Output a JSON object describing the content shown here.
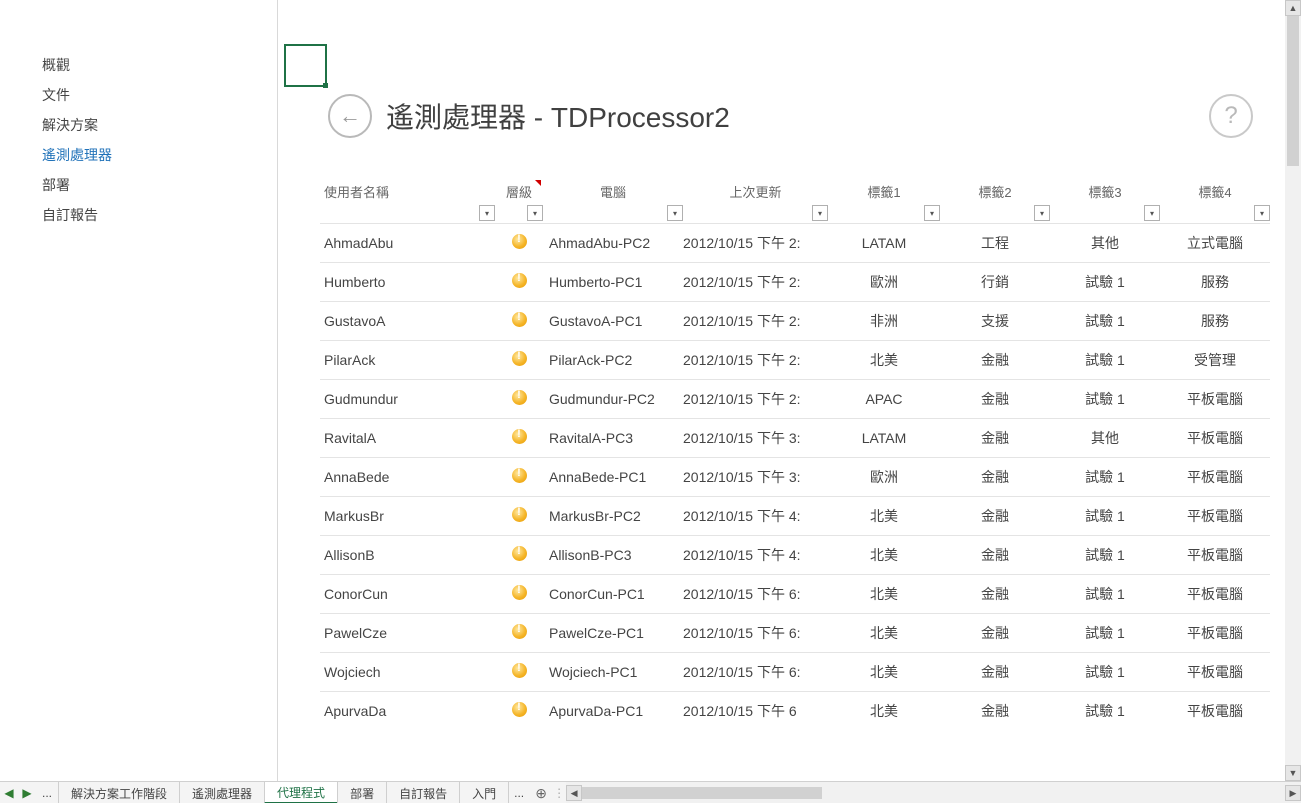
{
  "sidebar": {
    "items": [
      "概觀",
      "文件",
      "解決方案",
      "遙測處理器",
      "部署",
      "自訂報告"
    ],
    "selected_index": 3
  },
  "header": {
    "title": "遙測處理器 - TDProcessor2"
  },
  "columns": [
    "使用者名稱",
    "層級",
    "電腦",
    "上次更新",
    "標籤1",
    "標籤2",
    "標籤3",
    "標籤4"
  ],
  "column_with_marker": 1,
  "rows": [
    {
      "user": "AhmadAbu",
      "pc": "AhmadAbu-PC2",
      "updated": "2012/10/15 下午 2:",
      "t1": "LATAM",
      "t2": "工程",
      "t3": "其他",
      "t4": "立式電腦"
    },
    {
      "user": "Humberto",
      "pc": "Humberto-PC1",
      "updated": "2012/10/15 下午 2:",
      "t1": "歐洲",
      "t2": "行銷",
      "t3": "試驗 1",
      "t4": "服務"
    },
    {
      "user": "GustavoA",
      "pc": "GustavoA-PC1",
      "updated": "2012/10/15 下午 2:",
      "t1": "非洲",
      "t2": "支援",
      "t3": "試驗 1",
      "t4": "服務"
    },
    {
      "user": "PilarAck",
      "pc": "PilarAck-PC2",
      "updated": "2012/10/15 下午 2:",
      "t1": "北美",
      "t2": "金融",
      "t3": "試驗 1",
      "t4": "受管理"
    },
    {
      "user": "Gudmundur",
      "pc": "Gudmundur-PC2",
      "updated": "2012/10/15 下午 2:",
      "t1": "APAC",
      "t2": "金融",
      "t3": "試驗 1",
      "t4": "平板電腦"
    },
    {
      "user": "RavitalA",
      "pc": "RavitalA-PC3",
      "updated": "2012/10/15 下午 3:",
      "t1": "LATAM",
      "t2": "金融",
      "t3": "其他",
      "t4": "平板電腦"
    },
    {
      "user": "AnnaBede",
      "pc": "AnnaBede-PC1",
      "updated": "2012/10/15 下午 3:",
      "t1": "歐洲",
      "t2": "金融",
      "t3": "試驗 1",
      "t4": "平板電腦"
    },
    {
      "user": "MarkusBr",
      "pc": "MarkusBr-PC2",
      "updated": "2012/10/15 下午 4:",
      "t1": "北美",
      "t2": "金融",
      "t3": "試驗 1",
      "t4": "平板電腦"
    },
    {
      "user": "AllisonB",
      "pc": "AllisonB-PC3",
      "updated": "2012/10/15 下午 4:",
      "t1": "北美",
      "t2": "金融",
      "t3": "試驗 1",
      "t4": "平板電腦"
    },
    {
      "user": "ConorCun",
      "pc": "ConorCun-PC1",
      "updated": "2012/10/15 下午 6:",
      "t1": "北美",
      "t2": "金融",
      "t3": "試驗 1",
      "t4": "平板電腦"
    },
    {
      "user": "PawelCze",
      "pc": "PawelCze-PC1",
      "updated": "2012/10/15 下午 6:",
      "t1": "北美",
      "t2": "金融",
      "t3": "試驗 1",
      "t4": "平板電腦"
    },
    {
      "user": "Wojciech",
      "pc": "Wojciech-PC1",
      "updated": "2012/10/15 下午 6:",
      "t1": "北美",
      "t2": "金融",
      "t3": "試驗 1",
      "t4": "平板電腦"
    },
    {
      "user": "ApurvaDa",
      "pc": "ApurvaDa-PC1",
      "updated": "2012/10/15 下午 6",
      "t1": "北美",
      "t2": "金融",
      "t3": "試驗 1",
      "t4": "平板電腦"
    }
  ],
  "tabs": [
    "解決方案工作階段",
    "遙測處理器",
    "代理程式",
    "部署",
    "自訂報告",
    "入門"
  ],
  "active_tab_index": 2,
  "tab_more_label": "...",
  "tab_more_suffix": "..."
}
